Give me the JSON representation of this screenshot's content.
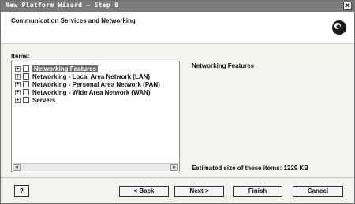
{
  "window": {
    "title": "New Platform Wizard — Step 8",
    "close_glyph": "✕"
  },
  "header": {
    "title": "Communication Services and Networking",
    "icon": "wizard-logo-icon"
  },
  "items_label": "Items:",
  "tree": {
    "items": [
      {
        "label": "Networking Features",
        "selected": true
      },
      {
        "label": "Networking - Local Area Network (LAN)",
        "selected": false
      },
      {
        "label": "Networking - Personal Area Network (PAN)",
        "selected": false
      },
      {
        "label": "Networking - Wide Area Network (WAN)",
        "selected": false
      },
      {
        "label": "Servers",
        "selected": false
      }
    ],
    "expander_glyph": "+"
  },
  "description": {
    "title": "Networking Features"
  },
  "size": {
    "text": "Estimated size of these items: 1229 KB"
  },
  "buttons": {
    "help": "?",
    "back": "< Back",
    "next": "Next >",
    "finish": "Finish",
    "cancel": "Cancel"
  },
  "colors": {
    "titlebar": "#7a7a7a",
    "selection": "#6e6e6e"
  }
}
